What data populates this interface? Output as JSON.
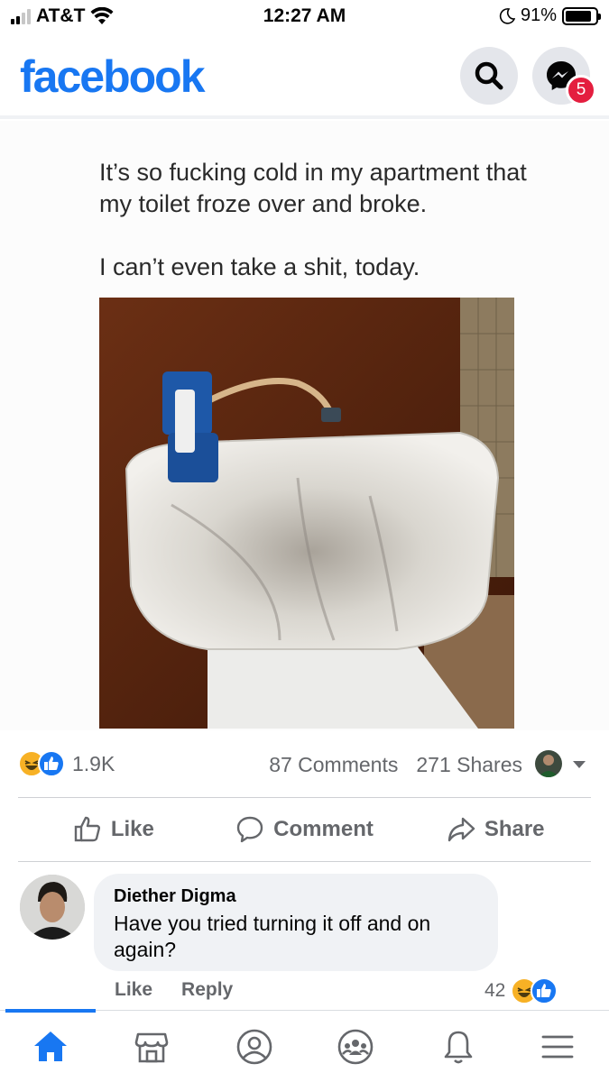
{
  "status_bar": {
    "carrier": "AT&T",
    "time": "12:27 AM",
    "battery": "91%"
  },
  "header": {
    "logo": "facebook",
    "messenger_badge": "5"
  },
  "post": {
    "meme_line1": "It’s so fucking cold in my apartment that my toilet froze over and broke.",
    "meme_line2": "I can’t even take a shit, today.",
    "reaction_count": "1.9K",
    "comments_count": "87 Comments",
    "shares_count": "271 Shares"
  },
  "actions": {
    "like": "Like",
    "comment": "Comment",
    "share": "Share"
  },
  "comment": {
    "author": "Diether Digma",
    "text": "Have you tried turning it off and on again?",
    "like_label": "Like",
    "reply_label": "Reply",
    "reaction_count": "42"
  },
  "colors": {
    "brand": "#1877f2",
    "badge": "#e41e3f",
    "muted": "#65676b"
  },
  "icons": {
    "header": [
      "search-icon",
      "messenger-icon"
    ],
    "bottom_nav": [
      "home-icon",
      "marketplace-icon",
      "profile-icon",
      "groups-icon",
      "notifications-icon",
      "menu-icon"
    ]
  }
}
